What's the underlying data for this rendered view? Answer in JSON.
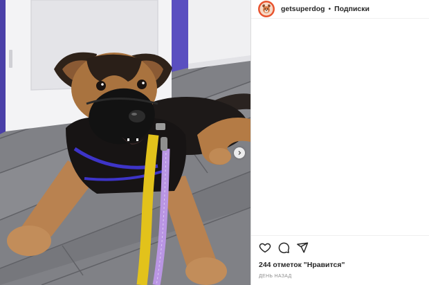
{
  "header": {
    "username": "getsuperdog",
    "separator": "•",
    "follow_label": "Подписки",
    "avatar_icon": "dog-avatar-icon"
  },
  "carousel": {
    "next_icon": "chevron-right-icon"
  },
  "actions": {
    "like_icon": "heart-icon",
    "comment_icon": "comment-icon",
    "share_icon": "send-icon"
  },
  "post": {
    "likes_text": "244 отметок \"Нравится\"",
    "timestamp": "ДЕНЬ НАЗАД"
  },
  "colors": {
    "text": "#262626",
    "muted": "#8e8e8e",
    "border": "#efefef",
    "avatar_bg": "#e8542f"
  }
}
